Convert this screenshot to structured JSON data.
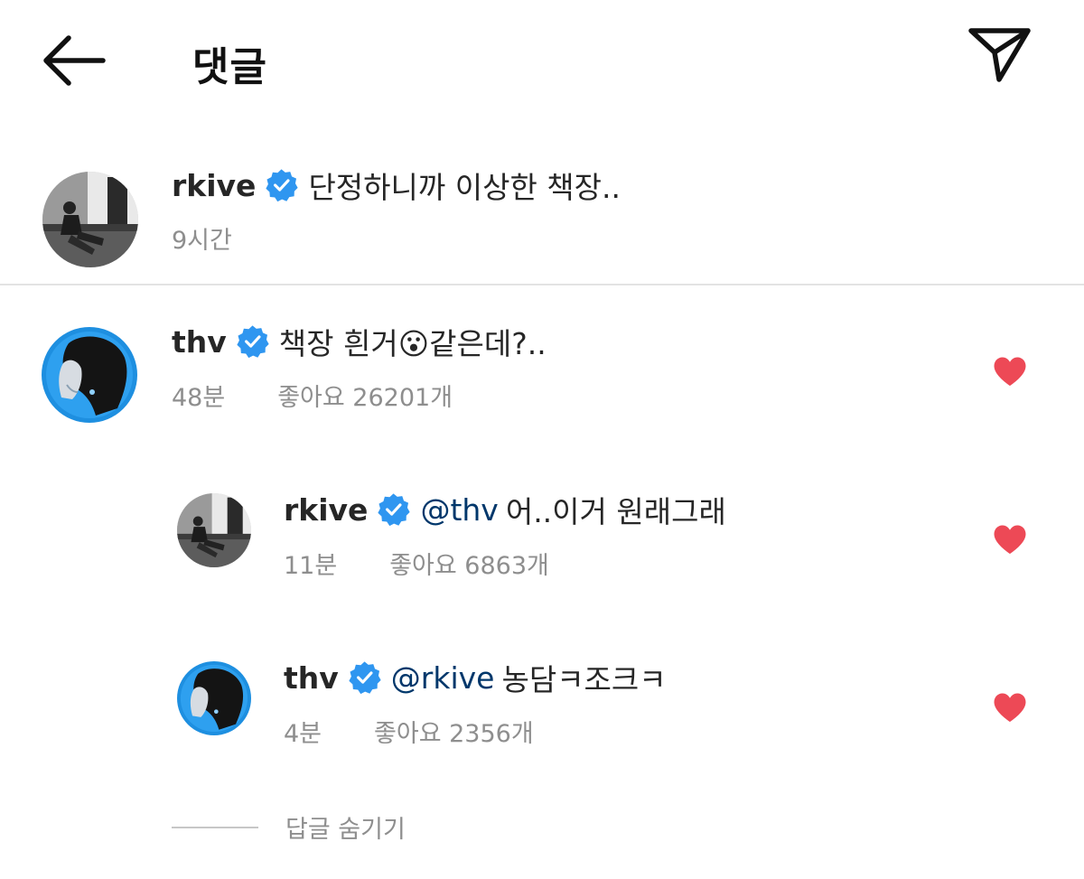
{
  "header": {
    "title": "댓글",
    "back_icon": "arrow-left-icon",
    "share_icon": "paper-plane-icon"
  },
  "caption": {
    "username": "rkive",
    "verified": true,
    "text": "단정하니까 이상한 책장..",
    "time": "9시간"
  },
  "comments": [
    {
      "username": "thv",
      "verified": true,
      "text": "책장 흰거😮같은데?..",
      "time": "48분",
      "likes": "좋아요 26201개",
      "liked": true
    },
    {
      "username": "rkive",
      "verified": true,
      "mention": "@thv",
      "text": "어..이거 원래그래",
      "time": "11분",
      "likes": "좋아요 6863개",
      "liked": true
    },
    {
      "username": "thv",
      "verified": true,
      "mention": "@rkive",
      "text": "농담ㅋ조크ㅋ",
      "time": "4분",
      "likes": "좋아요 2356개",
      "liked": true
    }
  ],
  "hide_replies_label": "답글 숨기기",
  "colors": {
    "verified_blue": "#2f96f0",
    "heart_red": "#ed4956",
    "meta_gray": "#8e8e8e",
    "mention_blue": "#00376b"
  }
}
